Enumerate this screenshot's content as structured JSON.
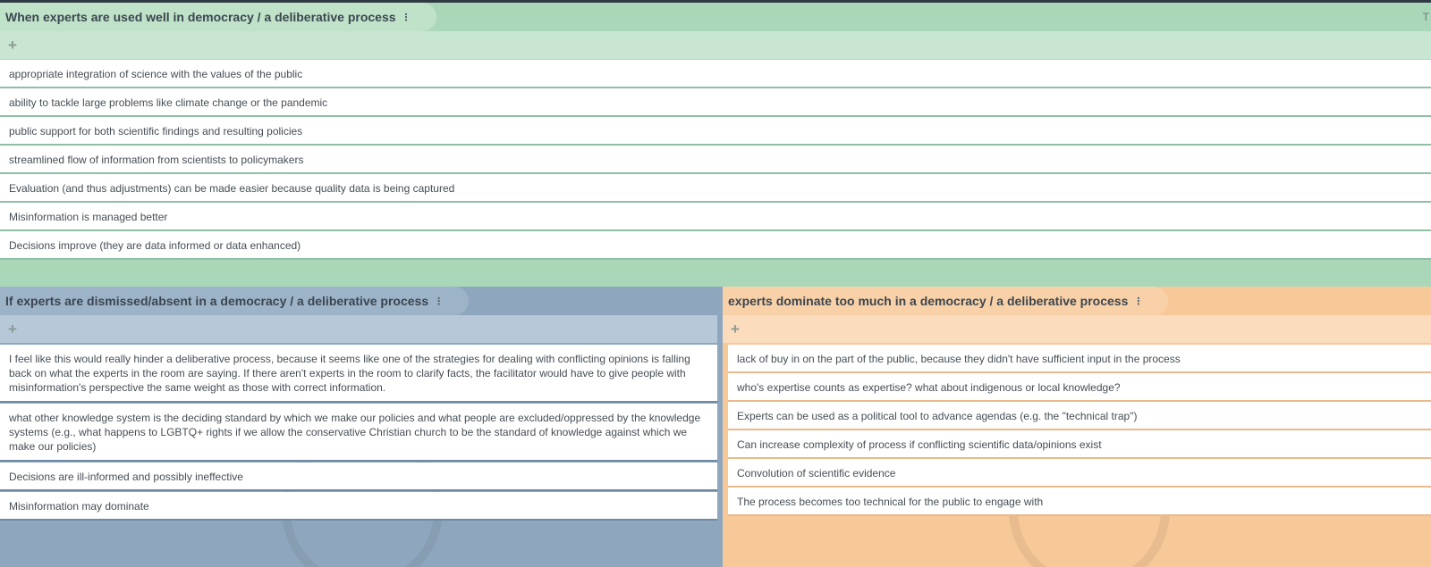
{
  "sections": {
    "top": {
      "title": "When experts are used well in democracy / a deliberative process",
      "corner_letter": "T",
      "add_glyph": "+",
      "items": [
        "appropriate integration of science with the values of the public",
        "ability to tackle large problems like climate change or the pandemic",
        "public support for both scientific findings and resulting policies",
        "streamlined flow of information from scientists to policymakers",
        "Evaluation (and thus adjustments) can be made easier because quality data is being captured",
        "Misinformation is managed better",
        "Decisions improve (they are data informed or data enhanced)"
      ]
    },
    "left": {
      "title": "If experts are dismissed/absent in a democracy / a deliberative process",
      "add_glyph": "+",
      "items": [
        "I feel like this would really hinder a deliberative process, because it seems like one of the strategies for dealing with conflicting opinions is falling back on what the experts in the room are saying. If there aren't experts in the room to clarify facts, the facilitator would have to give people with misinformation's perspective the same weight as those with correct information.",
        "what other knowledge system is the deciding standard by which we make our policies and what people are excluded/oppressed by the knowledge systems (e.g., what happens to LGBTQ+ rights if we allow the conservative Christian church to be the standard of knowledge against which we make our policies)",
        "Decisions are ill-informed and possibly ineffective",
        "Misinformation may dominate"
      ]
    },
    "right": {
      "title": "experts dominate too much in a democracy / a deliberative process",
      "add_glyph": "+",
      "items": [
        "lack of buy in on the part of the public, because they didn't have sufficient input in the process",
        "who's expertise counts as expertise? what about indigenous or local knowledge?",
        "Experts can be used as a political tool to advance agendas (e.g. the \"technical trap\")",
        "Can increase complexity of process if conflicting scientific data/opinions exist",
        "Convolution of scientific evidence",
        "The process becomes too technical for the public to engage with"
      ]
    }
  },
  "icons": {
    "kebab": "⋮",
    "plus": "plus-icon"
  },
  "colors": {
    "green": "#abd7b9",
    "blue": "#8fa7be",
    "orange": "#f7c898"
  }
}
